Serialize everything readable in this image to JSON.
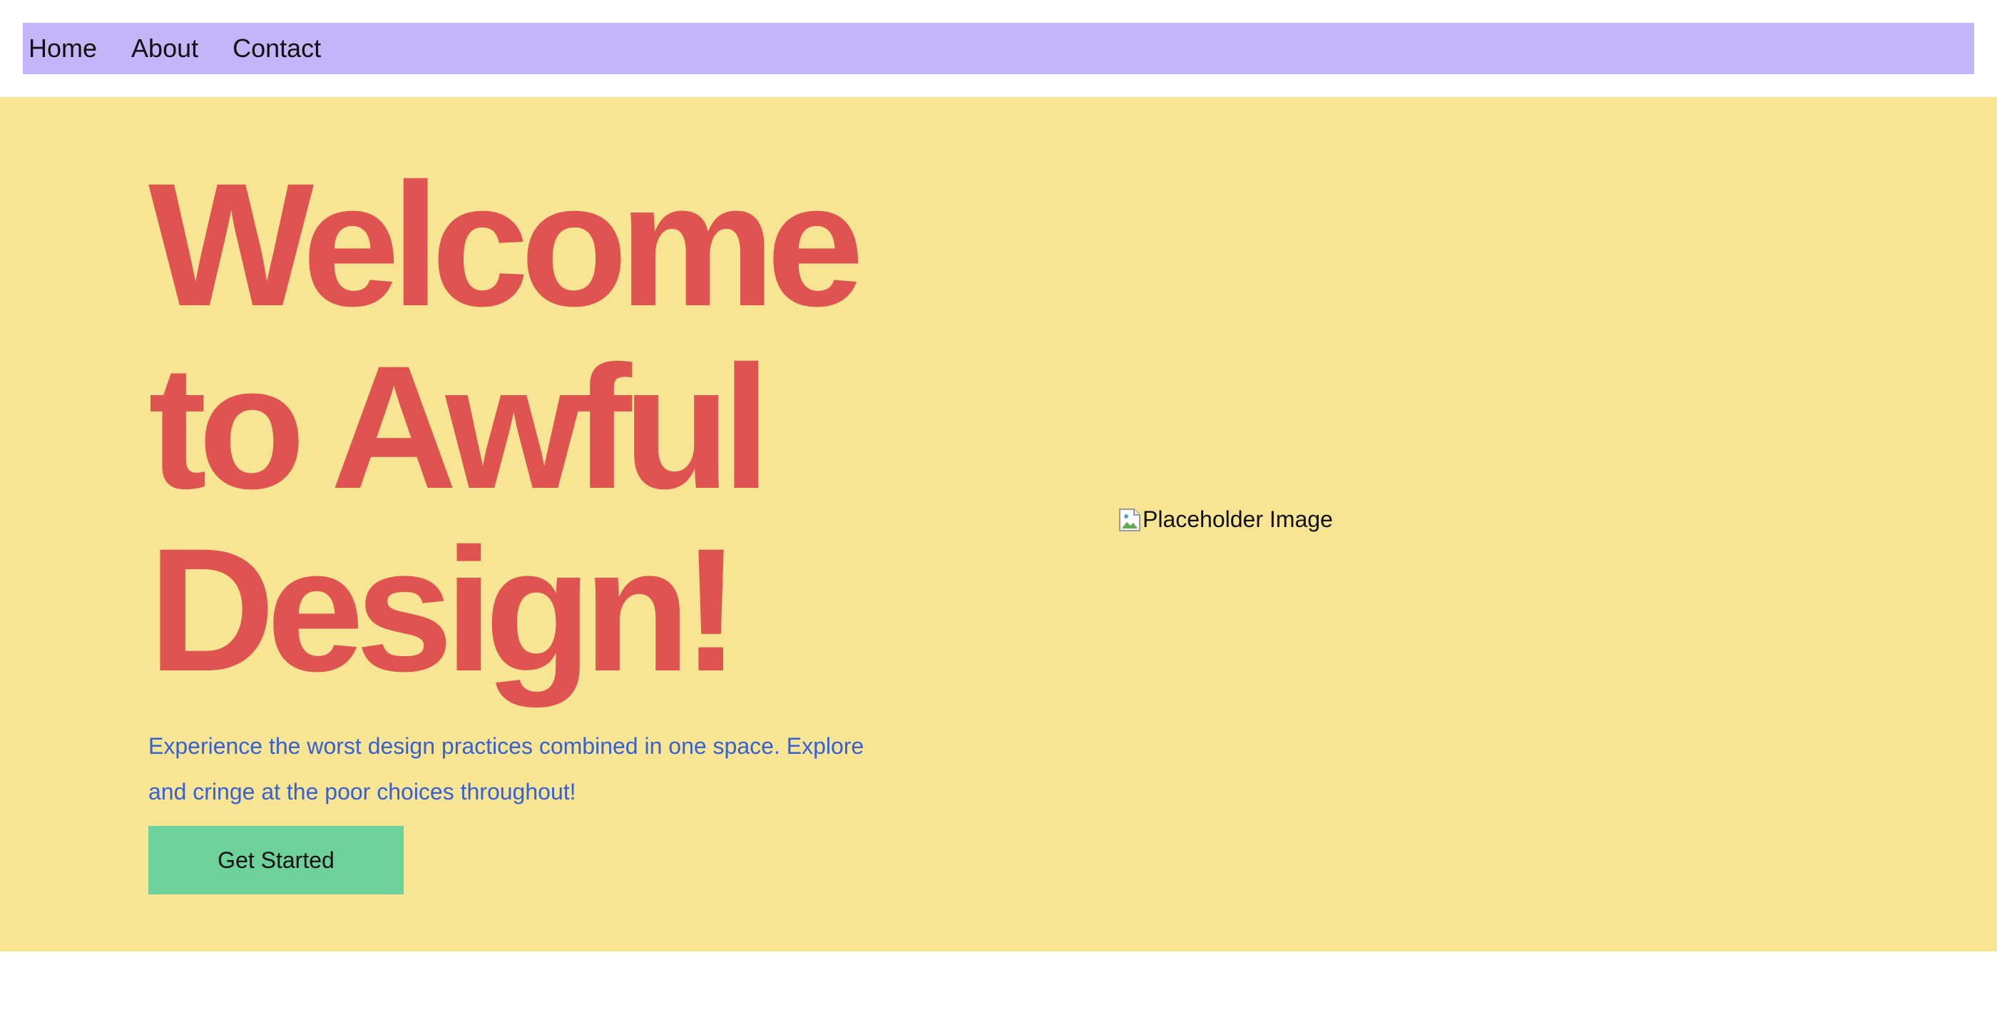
{
  "nav": {
    "items": [
      {
        "label": "Home"
      },
      {
        "label": "About"
      },
      {
        "label": "Contact"
      }
    ]
  },
  "hero": {
    "title": "Welcome to Awful Design!",
    "subtitle": "Experience the worst design practices combined in one space. Explore and cringe at the poor choices throughout!",
    "cta_label": "Get Started",
    "image_alt": "Placeholder Image"
  },
  "colors": {
    "nav_background": "#c4b5f8",
    "hero_background": "#f7e594",
    "title": "#df5350",
    "subtitle": "#3560d6",
    "cta_background": "#6dd19a"
  }
}
